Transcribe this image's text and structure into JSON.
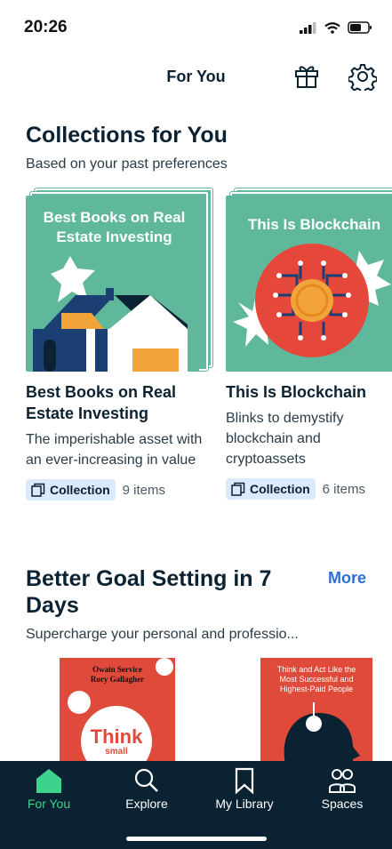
{
  "status_bar": {
    "time": "20:26"
  },
  "header": {
    "title": "For You"
  },
  "collections": {
    "title": "Collections for You",
    "subtitle": "Based on your past preferences",
    "cards": [
      {
        "cover_text": "Best Books on Real Estate Investing",
        "title": "Best Books on Real Estate Investing",
        "description": "The imperishable asset with an ever-increasing in value",
        "badge": "Collection",
        "count": "9 items"
      },
      {
        "cover_text": "This Is Blockchain",
        "title": "This Is Blockchain",
        "description": "Blinks to demystify blockchain and cryptoassets",
        "badge": "Collection",
        "count": "6 items"
      }
    ]
  },
  "goal_section": {
    "title": "Better Goal Setting in 7 Days",
    "more_label": "More",
    "subtitle": "Supercharge your personal and professio...",
    "books": [
      {
        "authors": "Owain Service\nRory Gallagher",
        "cover_word": "Think",
        "cover_word_small": "small"
      },
      {
        "cover_title": "Think and Act Like the Most Successful and Highest-Paid People"
      }
    ]
  },
  "bottom_nav": {
    "items": [
      {
        "label": "For You",
        "active": true
      },
      {
        "label": "Explore",
        "active": false
      },
      {
        "label": "My Library",
        "active": false
      },
      {
        "label": "Spaces",
        "active": false
      }
    ]
  },
  "colors": {
    "accent": "#3fd28c",
    "nav_bg": "#0b2233",
    "cover_green": "#5fb89c",
    "link_blue": "#2b6fd6",
    "book_red": "#e04a3a"
  }
}
